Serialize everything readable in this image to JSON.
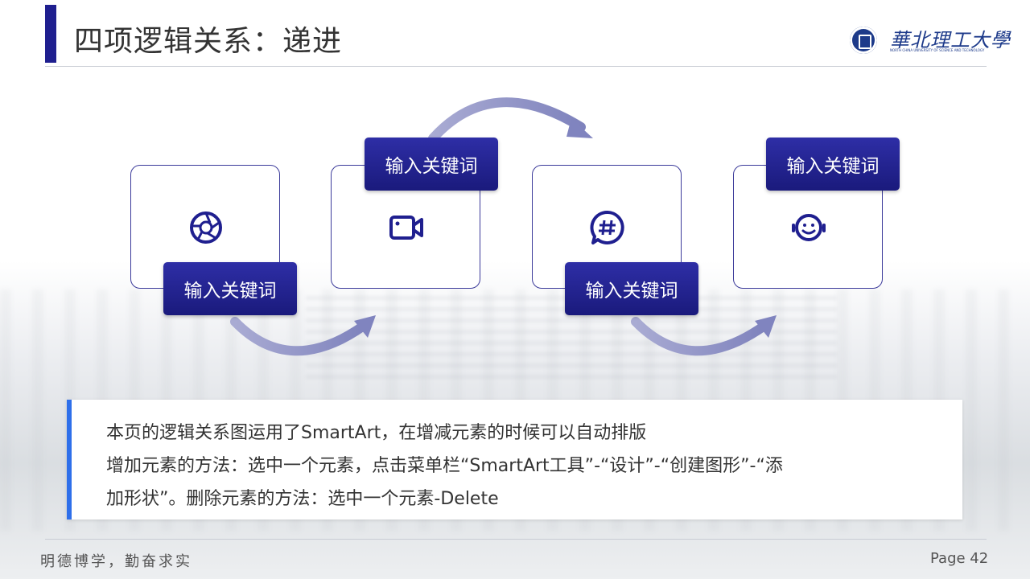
{
  "header": {
    "title": "四项逻辑关系：递进",
    "logo_text": "華北理工大學",
    "logo_sub": "NORTH CHINA UNIVERSITY OF SCIENCE AND TECHNOLOGY"
  },
  "steps": [
    {
      "label": "输入关键词",
      "icon": "camera-aperture-icon"
    },
    {
      "label": "输入关键词",
      "icon": "video-camera-icon"
    },
    {
      "label": "输入关键词",
      "icon": "hashtag-chat-icon"
    },
    {
      "label": "输入关键词",
      "icon": "smiley-headset-icon"
    }
  ],
  "note": {
    "line1": "本页的逻辑关系图运用了SmartArt，在增减元素的时候可以自动排版",
    "line2": "增加元素的方法：选中一个元素，点击菜单栏“SmartArt工具”-“设计”-“创建图形”-“添",
    "line3": "加形状”。删除元素的方法：选中一个元素-Delete"
  },
  "footer": {
    "motto": "明德博学，勤奋求实",
    "page": "Page 42"
  },
  "colors": {
    "primary": "#1f1f8f",
    "accent": "#2e6fea",
    "arrow": "#8f92c4"
  }
}
